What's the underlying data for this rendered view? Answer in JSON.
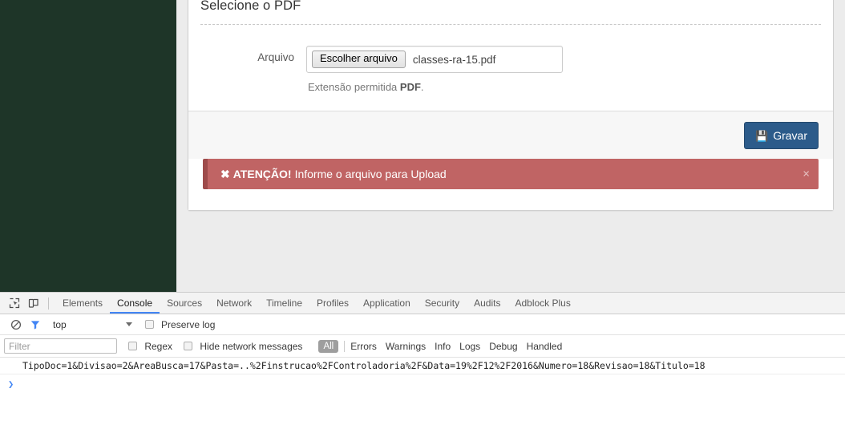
{
  "app": {
    "panel": {
      "title": "Selecione o PDF",
      "file_field": {
        "label": "Arquivo",
        "browse_button": "Escolher arquivo",
        "file_name": "classes-ra-15.pdf",
        "help_prefix": "Extensão permitida ",
        "help_strong": "PDF",
        "help_suffix": "."
      },
      "footer": {
        "save_label": "Gravar",
        "save_icon": "floppy-disk-icon",
        "save_icon_glyph": "💾"
      },
      "alert": {
        "x_mark": "✖",
        "strong": "ATENÇÃO!",
        "message": "Informe o arquivo para Upload",
        "close_glyph": "×",
        "background": "#c06464",
        "border": "#9e4b4b"
      }
    },
    "sidebar": {
      "background": "#1e3528"
    }
  },
  "devtools": {
    "toolbar_icons": [
      {
        "name": "inspect-element-icon"
      },
      {
        "name": "device-toolbar-icon"
      }
    ],
    "tabs": [
      {
        "label": "Elements",
        "active": false
      },
      {
        "label": "Console",
        "active": true
      },
      {
        "label": "Sources",
        "active": false
      },
      {
        "label": "Network",
        "active": false
      },
      {
        "label": "Timeline",
        "active": false
      },
      {
        "label": "Profiles",
        "active": false
      },
      {
        "label": "Application",
        "active": false
      },
      {
        "label": "Security",
        "active": false
      },
      {
        "label": "Audits",
        "active": false
      },
      {
        "label": "Adblock Plus",
        "active": false
      }
    ],
    "active_tab_color": "#4285f4",
    "console_toolbar": {
      "clear_icon": "clear-console-icon",
      "filter_icon": "filter-funnel-icon",
      "filter_icon_color": "#4285f4",
      "context": "top",
      "preserve_log_label": "Preserve log",
      "preserve_log_checked": false
    },
    "filter_bar": {
      "filter_placeholder": "Filter",
      "filter_value": "",
      "regex_label": "Regex",
      "regex_checked": false,
      "hide_network_label": "Hide network messages",
      "hide_network_checked": false,
      "levels": [
        {
          "label": "All",
          "active": true
        },
        {
          "label": "Errors",
          "active": false
        },
        {
          "label": "Warnings",
          "active": false
        },
        {
          "label": "Info",
          "active": false
        },
        {
          "label": "Logs",
          "active": false
        },
        {
          "label": "Debug",
          "active": false
        },
        {
          "label": "Handled",
          "active": false
        }
      ]
    },
    "messages": [
      "TipoDoc=1&Divisao=2&AreaBusca=17&Pasta=..%2Finstrucao%2FControladoria%2F&Data=19%2F12%2F2016&Numero=18&Revisao=18&Titulo=18"
    ],
    "prompt_glyph": "❯"
  }
}
